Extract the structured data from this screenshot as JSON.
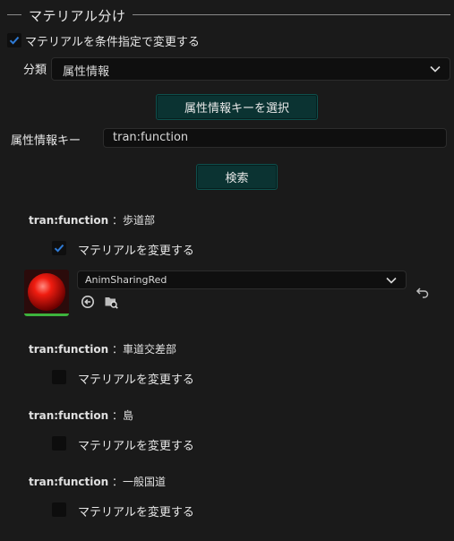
{
  "section": {
    "title": "マテリアル分け"
  },
  "main_toggle": {
    "label": "マテリアルを条件指定で変更する",
    "checked": true
  },
  "category": {
    "label": "分類",
    "value": "属性情報"
  },
  "select_key_button": {
    "label": "属性情報キーを選択"
  },
  "attribute_key": {
    "label": "属性情報キー",
    "value": "tran:function"
  },
  "search_button": {
    "label": "検索"
  },
  "results": [
    {
      "key": "tran:function",
      "value": "：歩道部",
      "toggle_label": "マテリアルを変更する",
      "checked": true,
      "material": {
        "name": "AnimSharingRed"
      }
    },
    {
      "key": "tran:function",
      "value": "：車道交差部",
      "toggle_label": "マテリアルを変更する",
      "checked": false
    },
    {
      "key": "tran:function",
      "value": "：島",
      "toggle_label": "マテリアルを変更する",
      "checked": false
    },
    {
      "key": "tran:function",
      "value": "：一般国道",
      "toggle_label": "マテリアルを変更する",
      "checked": false
    }
  ],
  "colors": {
    "accent_check": "#2f7bd6",
    "teal_button": "#0b3332",
    "thumb_underline": "#3db33d"
  },
  "icons": {
    "browse": "arrow-left-circle-icon",
    "find_in_browser": "folder-search-icon",
    "reset": "undo-arrow-icon",
    "dropdown": "chevron-down-icon"
  }
}
